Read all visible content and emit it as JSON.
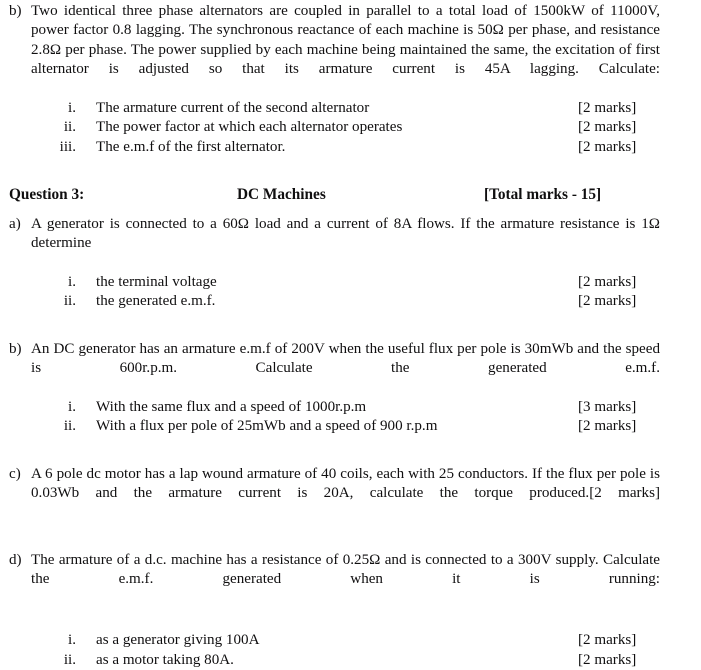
{
  "document": {
    "type": "exam-paper",
    "page_background": "#ffffff",
    "text_color": "#100f10"
  },
  "question2": {
    "part_b": {
      "label": "b)",
      "text": "Two identical three phase alternators are coupled in parallel to a total load of 1500kW of 11000V, power factor 0.8 lagging. The synchronous reactance of each machine is 50Ω per phase, and resistance 2.8Ω per phase. The power supplied by each machine being maintained the same, the excitation of first alternator is adjusted so that its armature current is 45A lagging. Calculate:",
      "items": [
        {
          "num": "i.",
          "text": "The armature current of the second alternator",
          "marks": "[2 marks]"
        },
        {
          "num": "ii.",
          "text": "The power factor at which each alternator operates",
          "marks": "[2 marks]"
        },
        {
          "num": "iii.",
          "text": "The e.m.f of the first alternator.",
          "marks": "[2 marks]"
        }
      ]
    }
  },
  "question3": {
    "heading": {
      "title": "Question 3:",
      "topic": "DC Machines",
      "total_marks": "[Total marks - 15]"
    },
    "part_a": {
      "label": "a)",
      "text": "A generator is connected to a 60Ω load and a current of 8A flows. If the armature resistance is 1Ω determine",
      "items": [
        {
          "num": "i.",
          "text": "the terminal voltage",
          "marks": "[2 marks]"
        },
        {
          "num": "ii.",
          "text": "the generated e.m.f.",
          "marks": "[2 marks]"
        }
      ]
    },
    "part_b": {
      "label": "b)",
      "text": "An DC generator has an armature e.m.f of 200V when the useful flux per pole is 30mWb and the speed is 600r.p.m. Calculate the generated e.m.f.",
      "items": [
        {
          "num": "i.",
          "text": "With the same flux and a speed of 1000r.p.m",
          "marks": "[3 marks]"
        },
        {
          "num": "ii.",
          "text": "With a flux per pole of 25mWb and a speed of 900 r.p.m",
          "marks": "[2 marks]"
        }
      ]
    },
    "part_c": {
      "label": "c)",
      "text": "A 6 pole dc motor has a lap wound armature of 40 coils, each with 25 conductors. If the flux per pole is 0.03Wb and the armature current is 20A, calculate the torque produced.",
      "marks": "[2 marks]"
    },
    "part_d": {
      "label": "d)",
      "text": "The armature of a d.c. machine has a resistance of 0.25Ω and is connected to a 300V supply. Calculate the e.m.f. generated when it is running:",
      "items": [
        {
          "num": "i.",
          "text": "as a generator giving 100A",
          "marks": "[2 marks]"
        },
        {
          "num": "ii.",
          "text": "as a motor taking 80A.",
          "marks": "[2 marks]"
        }
      ]
    }
  }
}
